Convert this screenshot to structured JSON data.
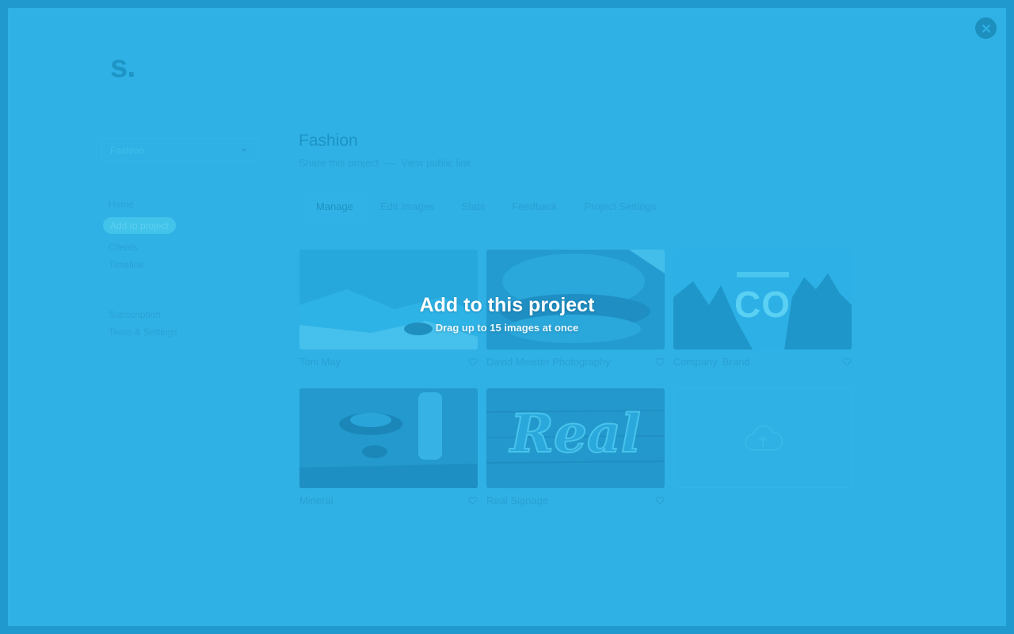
{
  "logo": "s.",
  "sidebar": {
    "project_select": "Fashion",
    "nav": [
      "Home",
      "Add to project",
      "Clients",
      "Timeline"
    ],
    "nav_active": "Add to project",
    "account": [
      "Subscription",
      "Team & Settings"
    ]
  },
  "project": {
    "title": "Fashion",
    "share": "Share this project",
    "separator": "—",
    "view_link": "View public link"
  },
  "tabs": [
    "Manage",
    "Edit Images",
    "Stats",
    "Feedback",
    "Project Settings"
  ],
  "active_tab": "Manage",
  "images": [
    {
      "caption": "Toni May"
    },
    {
      "caption": "David Meister Photography"
    },
    {
      "caption": "Company. Brand",
      "thumb_text": "CO"
    },
    {
      "caption": "Mineral"
    },
    {
      "caption": "Real Signage",
      "thumb_text": "Real"
    }
  ],
  "overlay": {
    "title": "Add to this project",
    "subtitle": "Drag up to 15 images at once"
  },
  "colors": {
    "overlay_bg": "#2fb1e5",
    "frame": "#2099cf",
    "close_button": "#1c8fbf"
  },
  "icons": {
    "close": "close-icon",
    "heart": "heart-icon",
    "upload": "cloud-upload-icon",
    "caret": "chevron-down-icon"
  }
}
